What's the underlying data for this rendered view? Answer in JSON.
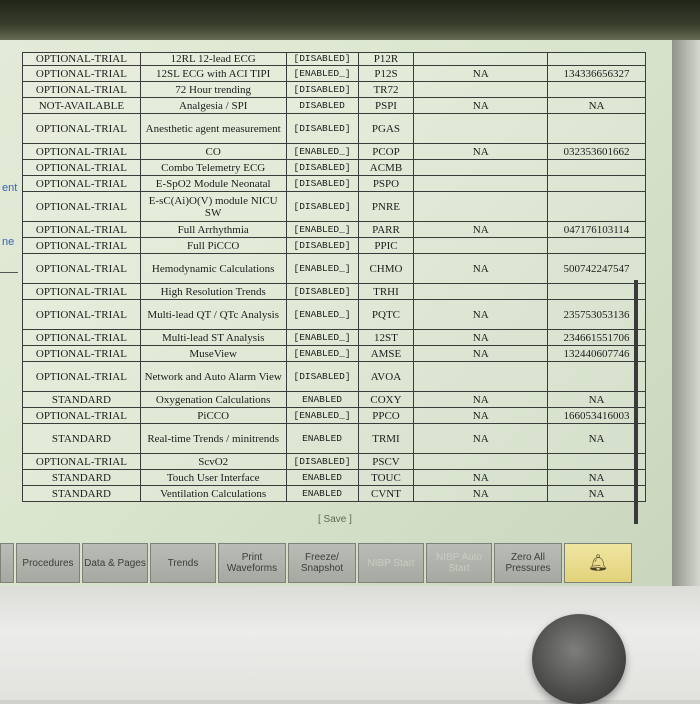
{
  "sidebar": {
    "text1": "ent",
    "text2": "ne"
  },
  "table": {
    "top_row_partial": {
      "availability": "OPTIONAL-TRIAL",
      "name": "12RL 12-lead ECG",
      "status": "[DISABLED]",
      "code": "P12R",
      "key": "",
      "serial": ""
    },
    "rows": [
      {
        "availability": "OPTIONAL-TRIAL",
        "name": "12SL ECG with ACI TIPI",
        "status": "[ENABLED_]",
        "code": "P12S",
        "key": "NA",
        "serial": "134336656327"
      },
      {
        "availability": "OPTIONAL-TRIAL",
        "name": "72 Hour trending",
        "status": "[DISABLED]",
        "code": "TR72",
        "key": "",
        "serial": ""
      },
      {
        "availability": "NOT-AVAILABLE",
        "name": "Analgesia / SPI",
        "status": "DISABLED",
        "code": "PSPI",
        "key": "NA",
        "serial": "NA"
      },
      {
        "availability": "OPTIONAL-TRIAL",
        "name": "Anesthetic agent measurement",
        "status": "[DISABLED]",
        "code": "PGAS",
        "key": "",
        "serial": ""
      },
      {
        "availability": "OPTIONAL-TRIAL",
        "name": "CO",
        "status": "[ENABLED_]",
        "code": "PCOP",
        "key": "NA",
        "serial": "032353601662"
      },
      {
        "availability": "OPTIONAL-TRIAL",
        "name": "Combo Telemetry ECG",
        "status": "[DISABLED]",
        "code": "ACMB",
        "key": "",
        "serial": ""
      },
      {
        "availability": "OPTIONAL-TRIAL",
        "name": "E-SpO2 Module Neonatal",
        "status": "[DISABLED]",
        "code": "PSPO",
        "key": "",
        "serial": ""
      },
      {
        "availability": "OPTIONAL-TRIAL",
        "name": "E-sC(Ai)O(V) module NICU SW",
        "status": "[DISABLED]",
        "code": "PNRE",
        "key": "",
        "serial": ""
      },
      {
        "availability": "OPTIONAL-TRIAL",
        "name": "Full Arrhythmia",
        "status": "[ENABLED_]",
        "code": "PARR",
        "key": "NA",
        "serial": "047176103114"
      },
      {
        "availability": "OPTIONAL-TRIAL",
        "name": "Full PiCCO",
        "status": "[DISABLED]",
        "code": "PPIC",
        "key": "",
        "serial": ""
      },
      {
        "availability": "OPTIONAL-TRIAL",
        "name": "Hemodynamic Calculations",
        "status": "[ENABLED_]",
        "code": "CHMO",
        "key": "NA",
        "serial": "500742247547"
      },
      {
        "availability": "OPTIONAL-TRIAL",
        "name": "High Resolution Trends",
        "status": "[DISABLED]",
        "code": "TRHI",
        "key": "",
        "serial": ""
      },
      {
        "availability": "OPTIONAL-TRIAL",
        "name": "Multi-lead QT / QTc Analysis",
        "status": "[ENABLED_]",
        "code": "PQTC",
        "key": "NA",
        "serial": "235753053136"
      },
      {
        "availability": "OPTIONAL-TRIAL",
        "name": "Multi-lead ST Analysis",
        "status": "[ENABLED_]",
        "code": "12ST",
        "key": "NA",
        "serial": "234661551706"
      },
      {
        "availability": "OPTIONAL-TRIAL",
        "name": "MuseView",
        "status": "[ENABLED_]",
        "code": "AMSE",
        "key": "NA",
        "serial": "132440607746"
      },
      {
        "availability": "OPTIONAL-TRIAL",
        "name": "Network and Auto Alarm View",
        "status": "[DISABLED]",
        "code": "AVOA",
        "key": "",
        "serial": ""
      },
      {
        "availability": "STANDARD",
        "name": "Oxygenation Calculations",
        "status": "ENABLED",
        "code": "COXY",
        "key": "NA",
        "serial": "NA"
      },
      {
        "availability": "OPTIONAL-TRIAL",
        "name": "PiCCO",
        "status": "[ENABLED_]",
        "code": "PPCO",
        "key": "NA",
        "serial": "166053416003"
      },
      {
        "availability": "STANDARD",
        "name": "Real-time Trends / minitrends",
        "status": "ENABLED",
        "code": "TRMI",
        "key": "NA",
        "serial": "NA"
      },
      {
        "availability": "OPTIONAL-TRIAL",
        "name": "ScvO2",
        "status": "[DISABLED]",
        "code": "PSCV",
        "key": "",
        "serial": ""
      },
      {
        "availability": "STANDARD",
        "name": "Touch User Interface",
        "status": "ENABLED",
        "code": "TOUC",
        "key": "NA",
        "serial": "NA"
      },
      {
        "availability": "STANDARD",
        "name": "Ventilation Calculations",
        "status": "ENABLED",
        "code": "CVNT",
        "key": "NA",
        "serial": "NA"
      }
    ]
  },
  "save_label": "[ Save ]",
  "softkeys": [
    {
      "label": "Procedures",
      "disabled": false
    },
    {
      "label": "Data & Pages",
      "disabled": false
    },
    {
      "label": "Trends",
      "disabled": false
    },
    {
      "label": "Print Waveforms",
      "disabled": false
    },
    {
      "label": "Freeze/ Snapshot",
      "disabled": false
    },
    {
      "label": "NIBP Start",
      "disabled": true
    },
    {
      "label": "NIBP Auto Start",
      "disabled": true
    },
    {
      "label": "Zero All Pressures",
      "disabled": false
    }
  ],
  "alarm_icon": "alarm-bell-icon",
  "colors": {
    "accent_blue": "#3b63b8",
    "alarm_yellow": "#e8da8a",
    "screen": "#dbe6cf"
  }
}
